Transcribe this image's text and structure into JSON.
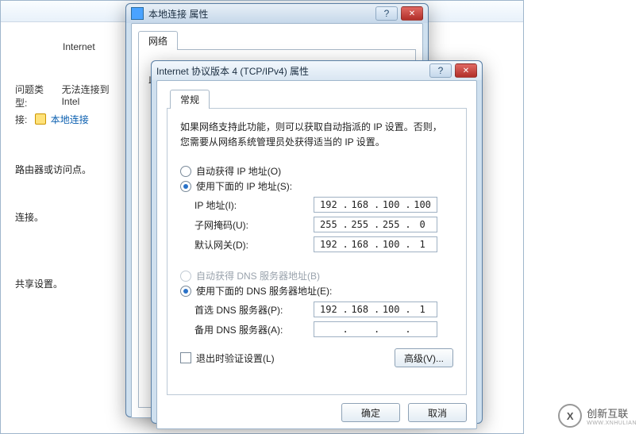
{
  "bg": {
    "internet_label": "Internet",
    "problem_type_label": "问题类型:",
    "problem_type_value": "无法连接到 Intel",
    "connection_label": "接:",
    "connection_link": "本地连接",
    "body_line1": "路由器或访问点。",
    "body_line2": "连接。",
    "body_line3": "共享设置。"
  },
  "win2": {
    "title": "本地连接 属性",
    "tab": "网络",
    "partial": "此"
  },
  "win3": {
    "title": "Internet 协议版本 4 (TCP/IPv4) 属性",
    "help_symbol": "?",
    "close_symbol": "✕",
    "tab": "常规",
    "desc_line1": "如果网络支持此功能，则可以获取自动指派的 IP 设置。否则，",
    "desc_line2": "您需要从网络系统管理员处获得适当的 IP 设置。",
    "r_auto_ip": "自动获得 IP 地址(O)",
    "r_use_ip": "使用下面的 IP 地址(S):",
    "ip_label": "IP 地址(I):",
    "ip_value": [
      "192",
      "168",
      "100",
      "100"
    ],
    "mask_label": "子网掩码(U):",
    "mask_value": [
      "255",
      "255",
      "255",
      "0"
    ],
    "gw_label": "默认网关(D):",
    "gw_value": [
      "192",
      "168",
      "100",
      "1"
    ],
    "r_auto_dns": "自动获得 DNS 服务器地址(B)",
    "r_use_dns": "使用下面的 DNS 服务器地址(E):",
    "dns1_label": "首选 DNS 服务器(P):",
    "dns1_value": [
      "192",
      "168",
      "100",
      "1"
    ],
    "dns2_label": "备用 DNS 服务器(A):",
    "dns2_value": [
      "",
      "",
      "",
      ""
    ],
    "validate": "退出时验证设置(L)",
    "advanced": "高级(V)...",
    "ok": "确定",
    "cancel": "取消"
  },
  "brand": {
    "name": "创新互联",
    "sub": "WWW.XNHULIAN"
  }
}
